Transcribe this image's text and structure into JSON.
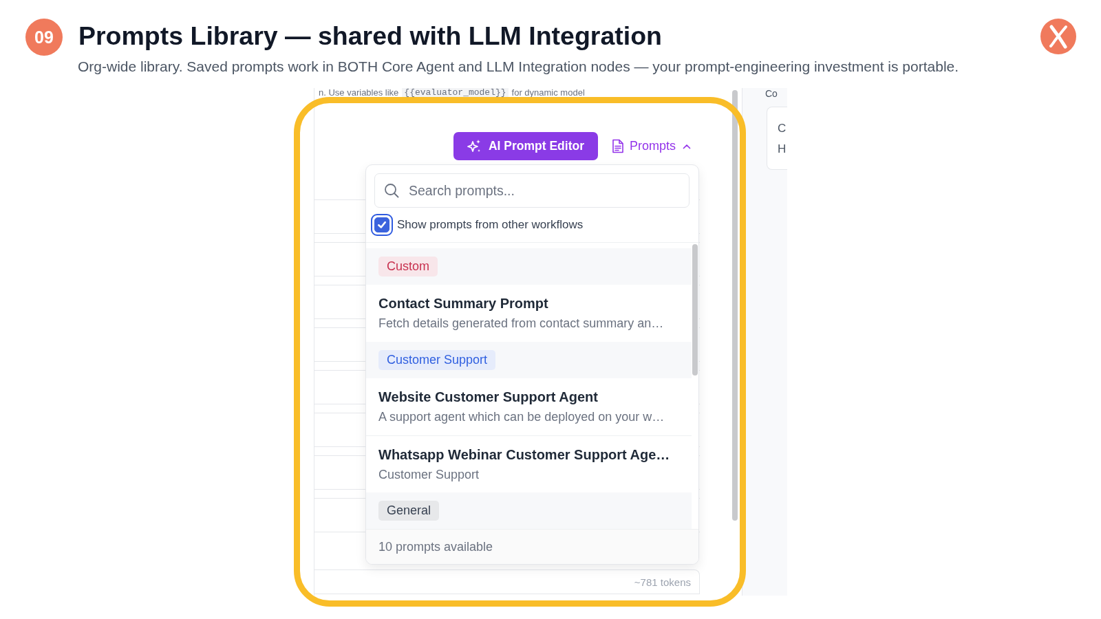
{
  "slide": {
    "number": "09",
    "title": "Prompts Library — shared with LLM Integration",
    "subtitle": "Org-wide library. Saved prompts work in BOTH Core Agent and LLM Integration nodes — your prompt-engineering investment is portable."
  },
  "screenshot": {
    "editor_hint": {
      "before": "n. Use variables like",
      "code": "{{evaluator_model}}",
      "after": "for dynamic model"
    },
    "toolbar": {
      "ai_button": "AI Prompt Editor",
      "prompts_button": {
        "label": "Prompts",
        "expanded": true
      }
    },
    "prompts_menu": {
      "search": {
        "placeholder": "Search prompts..."
      },
      "show_other_workflows": {
        "label": "Show prompts from other workflows",
        "checked": true
      },
      "entries": [
        {
          "kind": "group",
          "label": "Custom",
          "color": "#c8314f"
        },
        {
          "kind": "prompt",
          "title": "Contact Summary Prompt",
          "description": "Fetch details generated from contact summary an…"
        },
        {
          "kind": "group",
          "label": "Customer Support",
          "color": "#2f5fe0"
        },
        {
          "kind": "prompt",
          "title": "Website Customer Support Agent",
          "description": "A support agent which can be deployed on your w…"
        },
        {
          "kind": "prompt",
          "title": "Whatsapp Webinar Customer Support Age…",
          "description": "Customer Support"
        },
        {
          "kind": "group",
          "label": "General",
          "color": "#374151"
        }
      ],
      "footer": "10 prompts available"
    },
    "token_count": "~781 tokens",
    "side_panel": {
      "heading": "Co",
      "card_lines": [
        "C",
        "H"
      ]
    }
  }
}
